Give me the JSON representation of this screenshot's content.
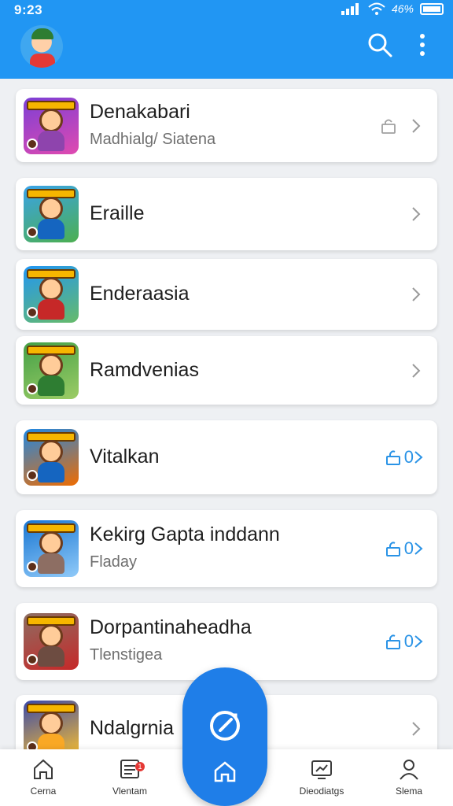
{
  "status_bar": {
    "time": "9:23",
    "battery_text": "46%"
  },
  "header": {
    "avatar_icon": "user-avatar",
    "search_icon": "search-icon",
    "more_icon": "more-vertical-icon"
  },
  "list": [
    {
      "title": "Denakabari",
      "subtitle": "Madhialg/ Siatena",
      "action": "lock",
      "thumb_colors": [
        "#7b3fd6",
        "#e04ab0"
      ],
      "torso": "#8e44ad"
    },
    {
      "title": "Eraille",
      "subtitle": "",
      "action": "chevron",
      "thumb_colors": [
        "#3aa3e8",
        "#4caf50"
      ],
      "torso": "#1565c0"
    },
    {
      "title": "Enderaasia",
      "subtitle": "",
      "action": "chevron",
      "thumb_colors": [
        "#2196f3",
        "#66bb6a"
      ],
      "torso": "#c62828"
    },
    {
      "title": "Ramdvenias",
      "subtitle": "",
      "action": "chevron",
      "thumb_colors": [
        "#43a047",
        "#9ccc65"
      ],
      "torso": "#2e7d32"
    },
    {
      "title": "Vitalkan",
      "subtitle": "",
      "action": "blue",
      "count": "0",
      "thumb_colors": [
        "#1e88e5",
        "#ef6c00"
      ],
      "torso": "#1565c0"
    },
    {
      "title": "Kekirg Gapta inddann",
      "subtitle": "Fladay",
      "action": "blue",
      "count": "0",
      "thumb_colors": [
        "#1976d2",
        "#90caf9"
      ],
      "torso": "#8d6e63"
    },
    {
      "title": "Dorpantinaheadha",
      "subtitle": "Tlenstigea",
      "action": "blue",
      "count": "0",
      "thumb_colors": [
        "#8d6e63",
        "#c62828"
      ],
      "torso": "#6d4c41"
    },
    {
      "title": "Ndalgrnia",
      "subtitle": "",
      "action": "chevron",
      "thumb_colors": [
        "#3949ab",
        "#fbc02d"
      ],
      "torso": "#f9a825"
    }
  ],
  "bottom_nav": [
    {
      "label": "Cerna",
      "icon": "home-icon"
    },
    {
      "label": "Vlentam",
      "icon": "news-icon",
      "badge": "1"
    },
    {
      "label": "Dieodiatgs",
      "icon": "chart-icon"
    },
    {
      "label": "Slema",
      "icon": "profile-icon"
    }
  ],
  "fab": {
    "icon": "compass-icon",
    "sub_icon": "home-icon"
  },
  "colors": {
    "accent": "#2196f3",
    "fab": "#1f7ee8",
    "action_blue": "#2a93e6"
  }
}
